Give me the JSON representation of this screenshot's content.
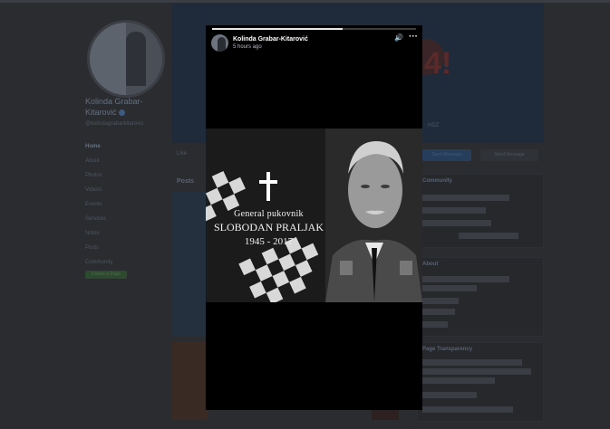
{
  "page": {
    "name": "Kolinda Grabar-Kitarović",
    "handle": "@kolindagrabarkitarovic",
    "nav": [
      "Home",
      "About",
      "Photos",
      "Videos",
      "Events",
      "Services",
      "Notes",
      "Posts",
      "Community"
    ],
    "create_page": "Create a Page",
    "like_button": "Like",
    "posts_tab": "Posts",
    "send_message": "Send Message",
    "message_button": "Send Message",
    "community_title": "Community",
    "about_title": "About",
    "transparency_title": "Page Transparency"
  },
  "story": {
    "author": "Kolinda Grabar-Kitarović",
    "time": "5 hours ago",
    "progress": 0.64,
    "caption_rank": "General pukovnik",
    "caption_name": "SLOBODAN PRALJAK",
    "caption_years": "1945 - 2017"
  },
  "icons": {
    "sound": "speaker-icon",
    "more": "more-options-icon",
    "cross": "memorial-cross-icon"
  },
  "colors": {
    "overlay": "#2a2c30",
    "viewer_bg": "#000000",
    "progress_fill": "#e6e6e6"
  }
}
